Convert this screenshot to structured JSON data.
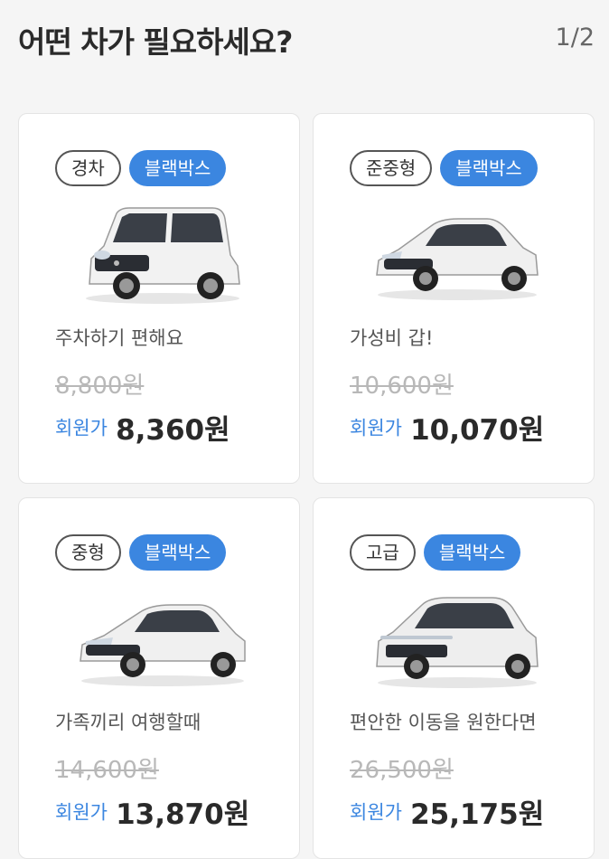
{
  "header": {
    "title": "어떤 차가 필요하세요?",
    "pager": "1/2"
  },
  "cards": [
    {
      "size_tag": "경차",
      "feature_tag": "블랙박스",
      "car_icon": "kei-car-icon",
      "description": "주차하기 편해요",
      "original_price": "8,800원",
      "member_label": "회원가",
      "member_price": "8,360원"
    },
    {
      "size_tag": "준중형",
      "feature_tag": "블랙박스",
      "car_icon": "compact-sedan-icon",
      "description": "가성비 갑!",
      "original_price": "10,600원",
      "member_label": "회원가",
      "member_price": "10,070원"
    },
    {
      "size_tag": "중형",
      "feature_tag": "블랙박스",
      "car_icon": "midsize-sedan-icon",
      "description": "가족끼리 여행할때",
      "original_price": "14,600원",
      "member_label": "회원가",
      "member_price": "13,870원"
    },
    {
      "size_tag": "고급",
      "feature_tag": "블랙박스",
      "car_icon": "luxury-sedan-icon",
      "description": "편안한 이동을 원한다면",
      "original_price": "26,500원",
      "member_label": "회원가",
      "member_price": "25,175원"
    }
  ],
  "colors": {
    "accent": "#3b86e0",
    "background": "#f5f5f5",
    "card": "#ffffff"
  }
}
